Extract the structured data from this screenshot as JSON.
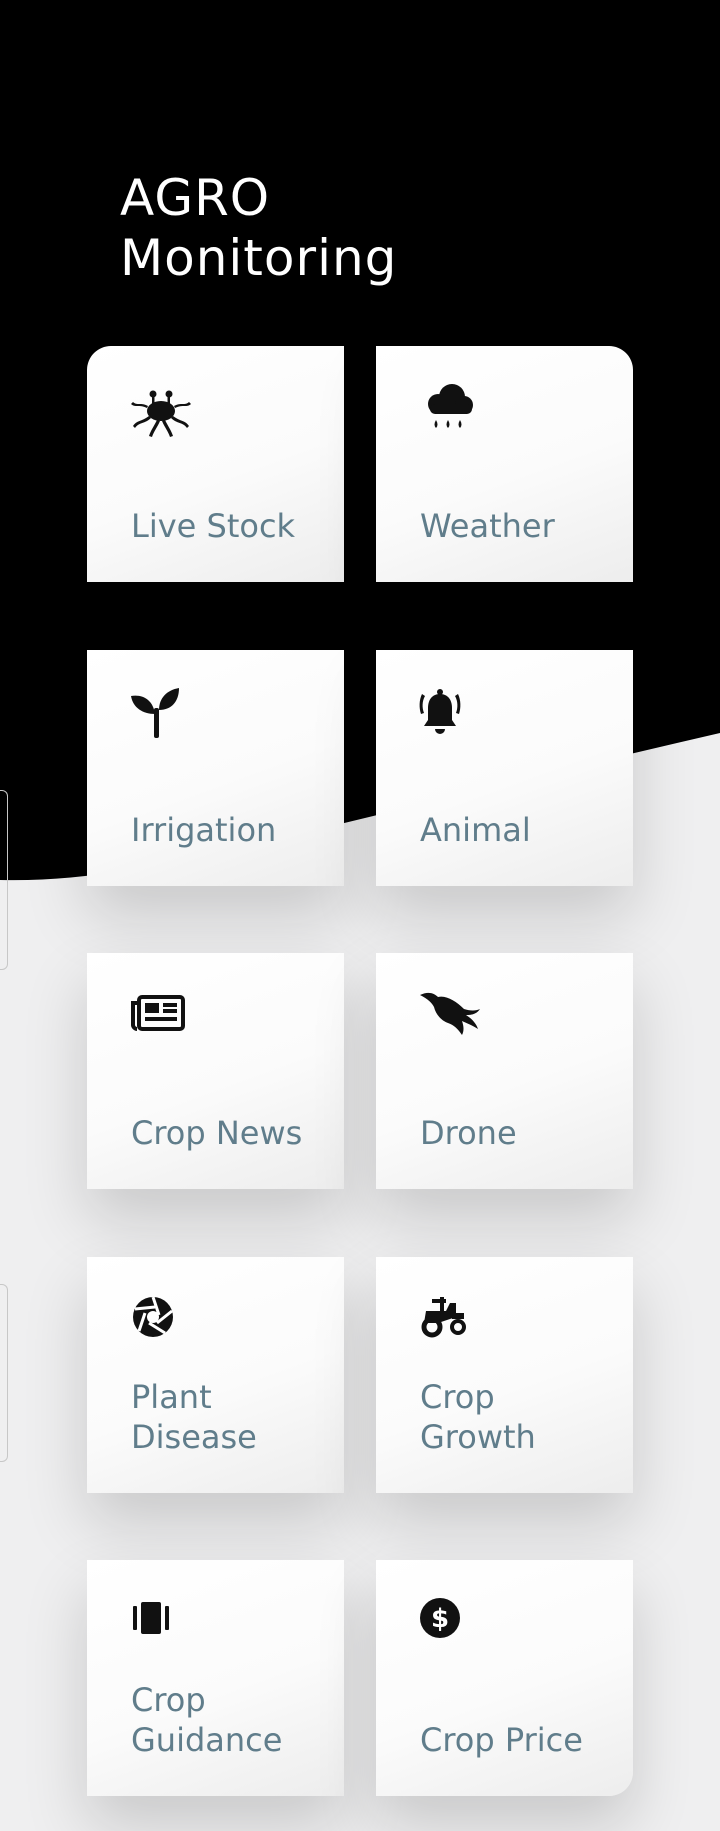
{
  "app": {
    "title_line1": "AGRO",
    "title_line2": "Monitoring"
  },
  "colors": {
    "header_bg": "#000000",
    "page_bg": "#efeff0",
    "card_bg": "#ffffff",
    "label_color": "#607d8b",
    "icon_color": "#111111"
  },
  "cards": [
    {
      "label": "Live Stock",
      "icon": "livestock-icon"
    },
    {
      "label": "Weather",
      "icon": "rain-cloud-icon"
    },
    {
      "label": "Irrigation",
      "icon": "seedling-icon"
    },
    {
      "label": "Animal",
      "icon": "bell-ringing-icon"
    },
    {
      "label": "Crop News",
      "icon": "newspaper-icon"
    },
    {
      "label": "Drone",
      "icon": "phoenix-bird-icon"
    },
    {
      "label": "Plant\nDisease",
      "icon": "aperture-icon"
    },
    {
      "label": "Crop\nGrowth",
      "icon": "tractor-icon"
    },
    {
      "label": "Crop\nGuidance",
      "icon": "carousel-icon"
    },
    {
      "label": "Crop Price",
      "icon": "dollar-circle-icon"
    }
  ]
}
